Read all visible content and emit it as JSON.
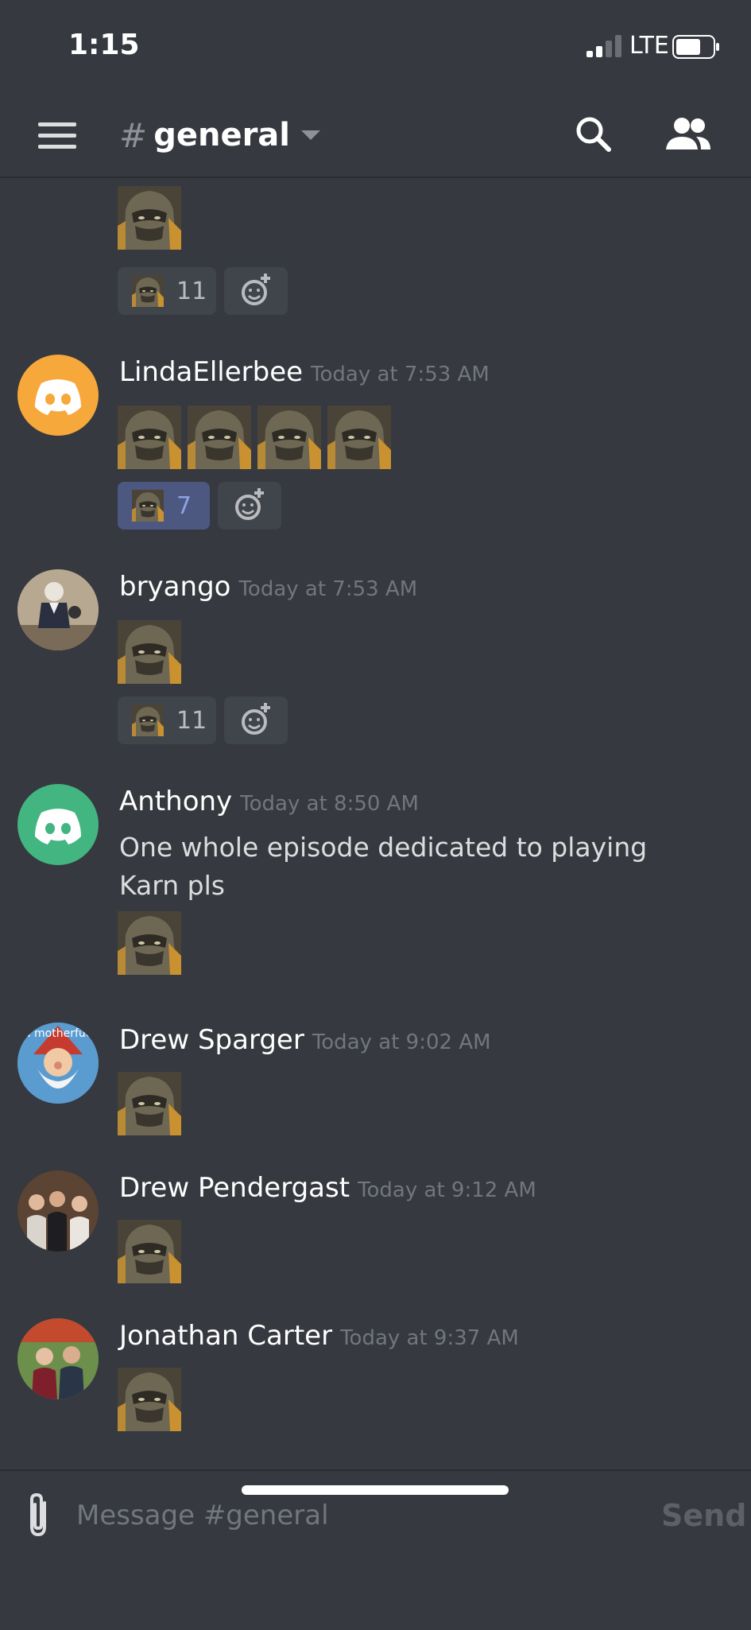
{
  "status": {
    "time": "1:15",
    "network": "LTE"
  },
  "header": {
    "channel_name": "general"
  },
  "reactions": {
    "karn_count_a": "11",
    "karn_count_b": "7",
    "karn_count_c": "11"
  },
  "messages": [
    {
      "author": "LindaEllerbee",
      "timestamp": "Today at 7:53 AM"
    },
    {
      "author": "bryango",
      "timestamp": "Today at 7:53 AM"
    },
    {
      "author": "Anthony",
      "timestamp": "Today at 8:50 AM",
      "text": "One whole episode dedicated to playing Karn pls"
    },
    {
      "author": "Drew Sparger",
      "timestamp": "Today at 9:02 AM"
    },
    {
      "author": "Drew Pendergast",
      "timestamp": "Today at 9:12 AM"
    },
    {
      "author": "Jonathan Carter",
      "timestamp": "Today at 9:37 AM"
    }
  ],
  "avatar_caption": "a motherfuc",
  "composer": {
    "placeholder": "Message #general",
    "send_label": "Send"
  },
  "icons": [
    "menu-icon",
    "search-icon",
    "members-icon",
    "paperclip-icon",
    "add-reaction-icon",
    "karn-emoji"
  ],
  "colors": {
    "background": "#36393f",
    "accent": "#7289da",
    "reaction_selected": "#4c5880"
  }
}
